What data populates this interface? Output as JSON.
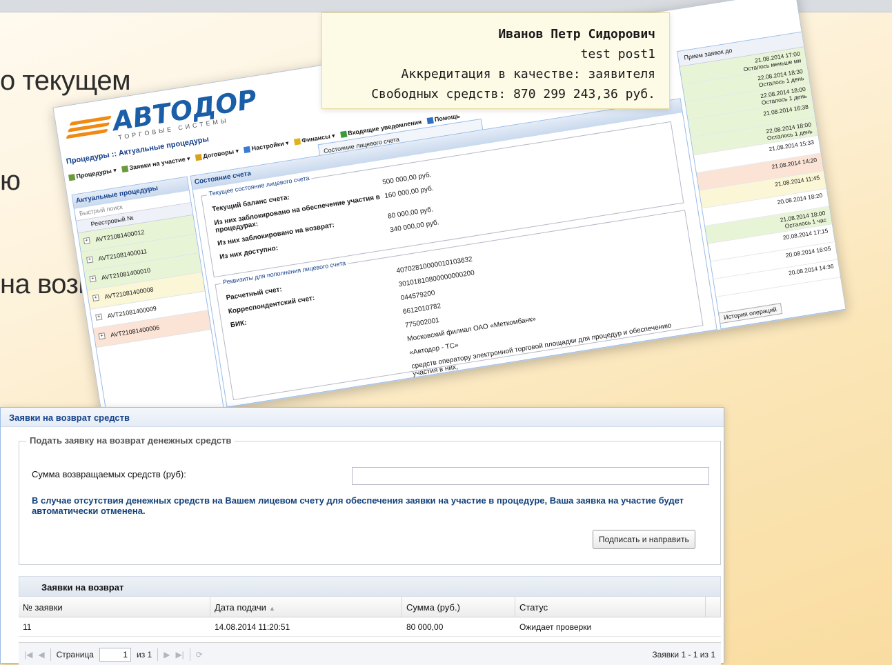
{
  "slide_text": [
    "о текущем",
    "ю",
    "на возврат"
  ],
  "user_box": {
    "name": "Иванов Петр Сидорович",
    "post": "test post1",
    "accreditation": "Аккредитация в качестве: заявителя",
    "funds": "Свободных средств: 870 299 243,36 руб."
  },
  "bg_app": {
    "logo_title": "АВТОДОР",
    "logo_subtitle": "ТОРГОВЫЕ СИСТЕМЫ",
    "breadcrumb": "Процедуры :: Актуальные процедуры",
    "menu": [
      "Процедуры",
      "Заявки на участие",
      "Договоры",
      "Настройки",
      "Финансы",
      "Входящие уведомления",
      "Помощь"
    ],
    "submenu_item": "Состояние лицевого счета",
    "left_panel_title": "Актуальные процедуры",
    "search_placeholder": "Быстрый поиск",
    "reg_no_header": "Реестровый №",
    "procedures": [
      "AVT21081400012",
      "AVT21081400011",
      "AVT21081400010",
      "AVT21081400008",
      "AVT21081400009",
      "AVT21081400006"
    ],
    "account_panel_title": "Состояние счета",
    "current_state_legend": "Текущее состояние лицевого счета",
    "current_state": [
      {
        "label": "Текущий баланс счета:",
        "value": "500 000,00 руб."
      },
      {
        "label": "Из них заблокировано на обеспечение участия в процедурах:",
        "value": "160 000,00 руб."
      },
      {
        "label": "Из них заблокировано на возврат:",
        "value": "80 000,00 руб."
      },
      {
        "label": "Из них доступно:",
        "value": "340 000,00 руб."
      }
    ],
    "requisites_legend": "Реквизиты для пополнения лицевого счета",
    "requisites": [
      {
        "label": "Расчетный счет:",
        "value": "40702810000010103632"
      },
      {
        "label": "Корреспондентский счет:",
        "value": "30101810800000000200"
      },
      {
        "label": "БИК:",
        "value": "044579200"
      },
      {
        "label": "",
        "value": "6612010782"
      },
      {
        "label": "",
        "value": "775002001"
      },
      {
        "label": "",
        "value": "Московский филиал ОАО «Меткомбанк»"
      },
      {
        "label": "",
        "value": "«Автодор - ТС»"
      },
      {
        "label": "",
        "value": "средств оператору электронной торговой площадки для процедур и обеспечению участия в них,"
      }
    ],
    "deadline_header": "Прием заявок до",
    "deadlines": [
      {
        "date": "21.08.2014 17:00",
        "note": "Осталось меньше ми"
      },
      {
        "date": "22.08.2014 18:30",
        "note": "Осталось 1 день"
      },
      {
        "date": "22.08.2014 18:00",
        "note": "Осталось 1 день"
      },
      {
        "date": "21.08.2014 16:38",
        "note": ""
      },
      {
        "date": "22.08.2014 18:00",
        "note": "Осталось 1 день"
      },
      {
        "date": "21.08.2014 15:33",
        "note": ""
      },
      {
        "date": "21.08.2014 14:20",
        "note": ""
      },
      {
        "date": "21.08.2014 11:45",
        "note": ""
      },
      {
        "date": "20.08.2014 18:20",
        "note": ""
      },
      {
        "date": "21.08.2014 18:00",
        "note": "Осталось 1 час"
      },
      {
        "date": "20.08.2014 17:15",
        "note": ""
      },
      {
        "date": "20.08.2014 16:05",
        "note": ""
      },
      {
        "date": "20.08.2014 14:36",
        "note": ""
      }
    ],
    "history_button": "История операций"
  },
  "window": {
    "title": "Заявки на возврат средств",
    "fieldset_legend": "Подать заявку на возврат денежных средств",
    "amount_label": "Сумма возвращаемых средств (руб):",
    "amount_value": "",
    "warning": "В случае отсутствия денежных средств на Вашем лицевом счету для обеспечения заявки на участие в процедуре, Ваша заявка на участие будет автоматически отменена.",
    "sign_button": "Подписать и направить",
    "grid": {
      "title": "Заявки на возврат",
      "columns": [
        "№ заявки",
        "Дата подачи",
        "Сумма (руб.)",
        "Статус"
      ],
      "rows": [
        {
          "no": "11",
          "date": "14.08.2014 11:20:51",
          "sum": "80 000,00",
          "status": "Ожидает проверки"
        }
      ]
    },
    "pager": {
      "page_label": "Страница",
      "page_value": "1",
      "of_label": "из 1",
      "summary": "Заявки 1 - 1 из 1"
    }
  }
}
